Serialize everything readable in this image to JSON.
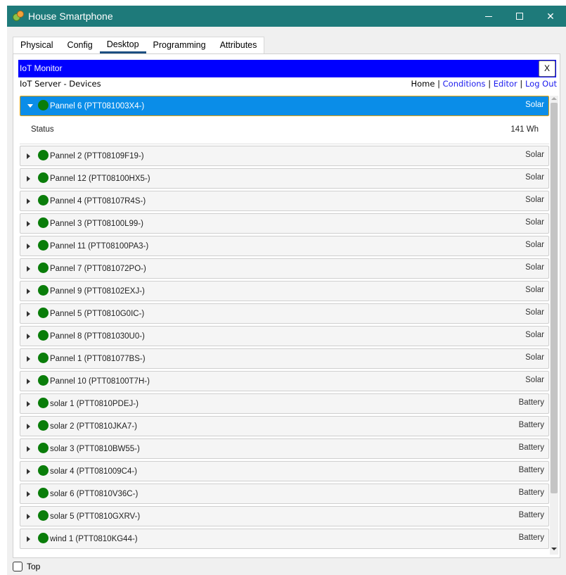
{
  "window": {
    "title": "House Smartphone",
    "controls": {
      "minimize": "minimize",
      "maximize": "maximize",
      "close": "✕"
    }
  },
  "tabs": [
    {
      "label": "Physical",
      "active": false
    },
    {
      "label": "Config",
      "active": false
    },
    {
      "label": "Desktop",
      "active": true
    },
    {
      "label": "Programming",
      "active": false
    },
    {
      "label": "Attributes",
      "active": false
    }
  ],
  "iot_monitor": {
    "title": "IoT Monitor",
    "close_label": "X",
    "subtitle": "IoT Server - Devices",
    "nav": {
      "home": "Home",
      "conditions": "Conditions",
      "editor": "Editor",
      "logout": "Log Out",
      "separator": "|"
    }
  },
  "devices": [
    {
      "name": "Pannel 6 (PTT081003X4-)",
      "type": "Solar",
      "expanded": true,
      "status": {
        "label": "Status",
        "value": "141 Wh"
      }
    },
    {
      "name": "Pannel 2 (PTT08109F19-)",
      "type": "Solar"
    },
    {
      "name": "Pannel 12 (PTT08100HX5-)",
      "type": "Solar"
    },
    {
      "name": "Pannel 4 (PTT08107R4S-)",
      "type": "Solar"
    },
    {
      "name": "Pannel 3 (PTT08100L99-)",
      "type": "Solar"
    },
    {
      "name": "Pannel 11 (PTT08100PA3-)",
      "type": "Solar"
    },
    {
      "name": "Pannel 7 (PTT081072PO-)",
      "type": "Solar"
    },
    {
      "name": "Pannel 9 (PTT08102EXJ-)",
      "type": "Solar"
    },
    {
      "name": "Pannel 5 (PTT0810G0IC-)",
      "type": "Solar"
    },
    {
      "name": "Pannel 8 (PTT081030U0-)",
      "type": "Solar"
    },
    {
      "name": "Pannel 1 (PTT081077BS-)",
      "type": "Solar"
    },
    {
      "name": "Pannel 10 (PTT08100T7H-)",
      "type": "Solar"
    },
    {
      "name": "solar 1 (PTT0810PDEJ-)",
      "type": "Battery"
    },
    {
      "name": "solar 2 (PTT0810JKA7-)",
      "type": "Battery"
    },
    {
      "name": "solar 3 (PTT0810BW55-)",
      "type": "Battery"
    },
    {
      "name": "solar 4 (PTT081009C4-)",
      "type": "Battery"
    },
    {
      "name": "solar 6 (PTT0810V36C-)",
      "type": "Battery"
    },
    {
      "name": "solar 5 (PTT0810GXRV-)",
      "type": "Battery"
    },
    {
      "name": "wind 1 (PTT0810KG44-)",
      "type": "Battery"
    }
  ],
  "colors": {
    "titlebar": "#1e7a7a",
    "iot_header": "#0000ff",
    "selected_row": "#0a8de8",
    "selected_border": "#f0a000",
    "status_dot": "#0a7d0a",
    "link": "#1a1aee"
  },
  "bottom": {
    "top_checkbox_label": "Top",
    "checked": false
  }
}
